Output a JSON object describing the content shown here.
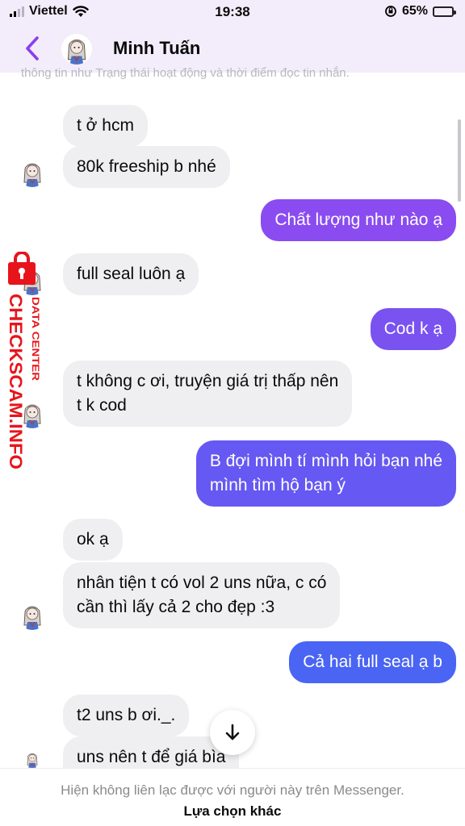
{
  "status_bar": {
    "carrier": "Viettel",
    "time": "19:38",
    "battery": "65%"
  },
  "header": {
    "contact_name": "Minh Tuấn",
    "faded_text": "thông tin như Trạng thái hoạt động và thời điểm đọc tin nhắn."
  },
  "colors": {
    "outgoing_top": "#8a4cf0",
    "outgoing_mid": "#6a57f2",
    "outgoing_bottom": "#4a64f3",
    "back_arrow": "#8a3ff0",
    "watermark": "#e8141b"
  },
  "messages": [
    {
      "from": "them",
      "text": "t ở hcm"
    },
    {
      "from": "them",
      "text": "80k freeship b nhé"
    },
    {
      "from": "me",
      "text": "Chất lượng như nào ạ"
    },
    {
      "from": "them",
      "text": "full seal luôn ạ"
    },
    {
      "from": "me",
      "text": "Cod k ạ"
    },
    {
      "from": "them",
      "line1": "t không c ơi, truyện giá trị thấp nên",
      "line2": "t k cod"
    },
    {
      "from": "me",
      "line1": "B đợi mình tí mình hỏi bạn nhé",
      "line2": "mình tìm hộ bạn ý"
    },
    {
      "from": "them",
      "text": "ok ạ"
    },
    {
      "from": "them",
      "line1": "nhân tiện t có vol 2 uns nữa, c có",
      "line2": "cần thì lấy cả 2 cho đẹp :3"
    },
    {
      "from": "me",
      "text": "Cả hai full seal ạ b"
    },
    {
      "from": "them",
      "text": "t2 uns b ơi._."
    },
    {
      "from": "them",
      "text": "uns nên t để giá bìa"
    }
  ],
  "watermark": {
    "brand": "CHECKSCAM.INFO",
    "sub": "DATA CENTER"
  },
  "footer": {
    "notice": "Hiện không liên lạc được với người này trên Messenger.",
    "link": "Lựa chọn khác"
  }
}
